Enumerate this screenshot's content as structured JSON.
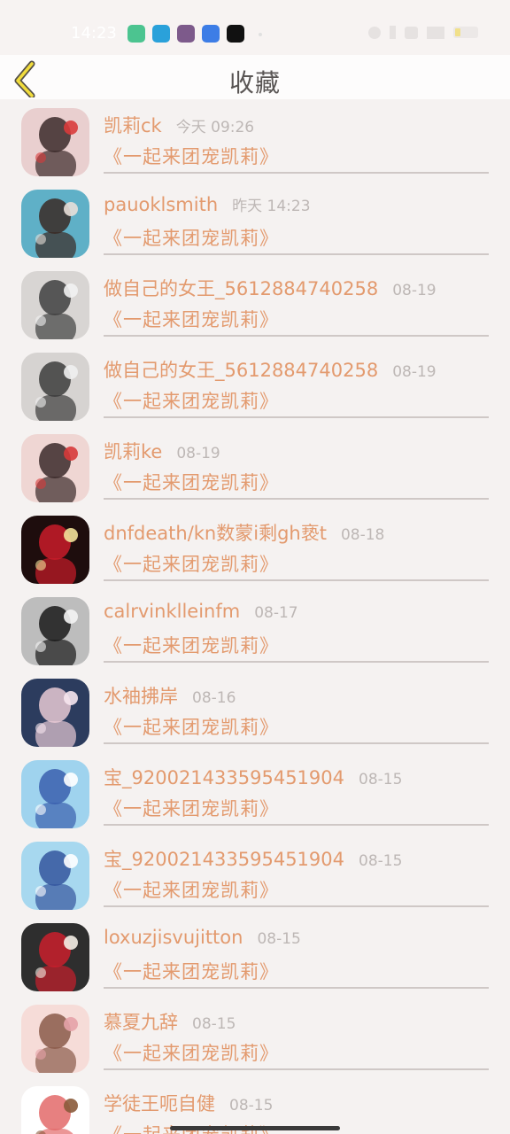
{
  "status": {
    "time": "14:23",
    "apps": [
      {
        "icon": "messages-app-icon",
        "color": "#4cc490"
      },
      {
        "icon": "telegram-app-icon",
        "color": "#2aa1da"
      },
      {
        "icon": "game-app-icon",
        "color": "#7d5a8b"
      },
      {
        "icon": "chat-app-icon",
        "color": "#3d7de6"
      },
      {
        "icon": "capcut-app-icon",
        "color": "#111111"
      }
    ]
  },
  "header": {
    "title": "收藏"
  },
  "items": [
    {
      "name": "凯莉ck",
      "date": "今天 09:26",
      "post": "《一起来团宠凯莉》",
      "avatar": {
        "bg": "#e9cfcf",
        "fg": "#3b2a2a",
        "accent": "#d93b3b"
      }
    },
    {
      "name": "pauoklsmith",
      "date": "昨天 14:23",
      "post": "《一起来团宠凯莉》",
      "avatar": {
        "bg": "#5fb0c7",
        "fg": "#3a2a24",
        "accent": "#e8dfd8"
      }
    },
    {
      "name": "做自己的女王_5612884740258",
      "date": "08-19",
      "post": "《一起来团宠凯莉》",
      "avatar": {
        "bg": "#d8d5d3",
        "fg": "#404040",
        "accent": "#f2f2f2"
      }
    },
    {
      "name": "做自己的女王_5612884740258",
      "date": "08-19",
      "post": "《一起来团宠凯莉》",
      "avatar": {
        "bg": "#d6d3d1",
        "fg": "#3c3c3c",
        "accent": "#f0f0f0"
      }
    },
    {
      "name": "凯莉ke",
      "date": "08-19",
      "post": "《一起来团宠凯莉》",
      "avatar": {
        "bg": "#efd6d3",
        "fg": "#3b2a2a",
        "accent": "#d73a3a"
      }
    },
    {
      "name": "dnfdeath/kn数蒙i剩gh亵t",
      "date": "08-18",
      "post": "《一起来团宠凯莉》",
      "avatar": {
        "bg": "#1e0d0d",
        "fg": "#c91c2a",
        "accent": "#f2e29a"
      }
    },
    {
      "name": "calrvinklleinfm",
      "date": "08-17",
      "post": "《一起来团宠凯莉》",
      "avatar": {
        "bg": "#bdbdbd",
        "fg": "#1a1a1a",
        "accent": "#f4f4f4"
      }
    },
    {
      "name": "水袖拂岸",
      "date": "08-16",
      "post": "《一起来团宠凯莉》",
      "avatar": {
        "bg": "#2c3c5e",
        "fg": "#e7c9d4",
        "accent": "#f6e6ee"
      }
    },
    {
      "name": "宝_920021433595451904",
      "date": "08-15",
      "post": "《一起来团宠凯莉》",
      "avatar": {
        "bg": "#9fd3ee",
        "fg": "#3a5fae",
        "accent": "#ffffff"
      }
    },
    {
      "name": "宝_920021433595451904",
      "date": "08-15",
      "post": "《一起来团宠凯莉》",
      "avatar": {
        "bg": "#a7d8ef",
        "fg": "#34569e",
        "accent": "#ffffff"
      }
    },
    {
      "name": "loxuzjisvujitton",
      "date": "08-15",
      "post": "《一起来团宠凯莉》",
      "avatar": {
        "bg": "#2e2e2e",
        "fg": "#c91f2c",
        "accent": "#f4eee6"
      }
    },
    {
      "name": "慕夏九辞",
      "date": "08-15",
      "post": "《一起来团宠凯莉》",
      "avatar": {
        "bg": "#f6dcd8",
        "fg": "#8a5a4a",
        "accent": "#e6a2a8"
      }
    },
    {
      "name": "学徒王呃自健",
      "date": "08-15",
      "post": "《一起来团宠凯莉》",
      "avatar": {
        "bg": "#ffffff",
        "fg": "#e36a6a",
        "accent": "#8a5a3a"
      }
    }
  ]
}
